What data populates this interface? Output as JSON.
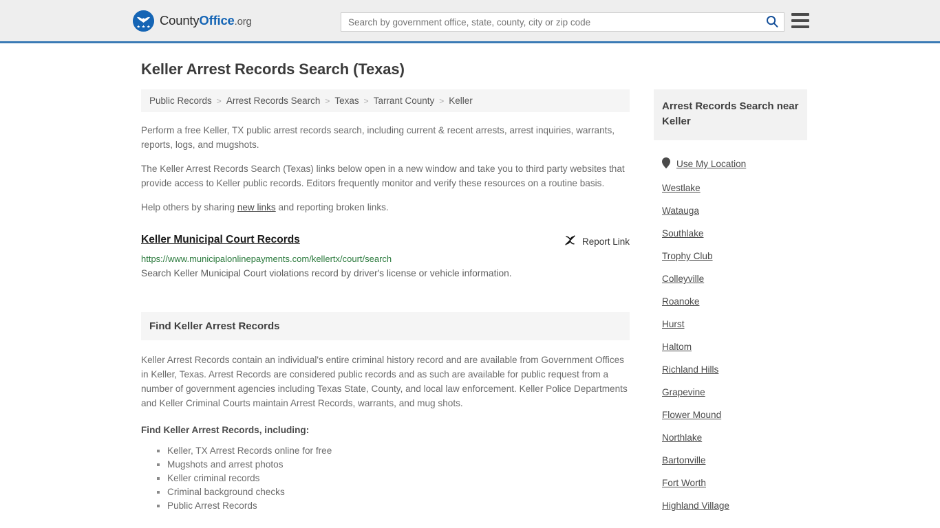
{
  "header": {
    "logo": {
      "icon": "eagle-shield-logo-icon",
      "text_part1": "County",
      "text_part2": "Office",
      "text_part3": ".org"
    },
    "search": {
      "placeholder": "Search by government office, state, county, city or zip code",
      "value": "",
      "search_icon": "search-icon"
    },
    "menu_icon": "hamburger-menu-icon",
    "accent_color": "#3b7ab5",
    "background_color": "#eeeeee"
  },
  "page_title": "Keller Arrest Records Search (Texas)",
  "breadcrumb": {
    "separator": ">",
    "items": [
      {
        "label": "Public Records"
      },
      {
        "label": "Arrest Records Search"
      },
      {
        "label": "Texas"
      },
      {
        "label": "Tarrant County"
      },
      {
        "label": "Keller"
      }
    ]
  },
  "intro": {
    "paragraph_1": "Perform a free Keller, TX public arrest records search, including current & recent arrests, arrest inquiries, warrants, reports, logs, and mugshots.",
    "paragraph_2": "The Keller Arrest Records Search (Texas) links below open in a new window and take you to third party websites that provide access to Keller public records. Editors frequently monitor and verify these resources on a routine basis.",
    "share_prefix": "Help others by sharing ",
    "share_link": "new links",
    "share_suffix": " and reporting broken links."
  },
  "results": [
    {
      "title": "Keller Municipal Court Records",
      "url": "https://www.municipalonlinepayments.com/kellertx/court/search",
      "description": "Search Keller Municipal Court violations record by driver's license or vehicle information.",
      "report_label": "Report Link",
      "report_icon": "broken-link-icon",
      "url_color": "#2b7a3d"
    }
  ],
  "section": {
    "heading": "Find Keller Arrest Records",
    "body": "Keller Arrest Records contain an individual's entire criminal history record and are available from Government Offices in Keller, Texas. Arrest Records are considered public records and as such are available for public request from a number of government agencies including Texas State, County, and local law enforcement. Keller Police Departments and Keller Criminal Courts maintain Arrest Records, warrants, and mug shots.",
    "list_intro": "Find Keller Arrest Records, including:",
    "list_items": [
      "Keller, TX Arrest Records online for free",
      "Mugshots and arrest photos",
      "Keller criminal records",
      "Criminal background checks",
      "Public Arrest Records"
    ]
  },
  "sidebar": {
    "heading": "Arrest Records Search near Keller",
    "location_item": {
      "label": "Use My Location",
      "icon": "map-pin-icon"
    },
    "items": [
      {
        "label": "Westlake"
      },
      {
        "label": "Watauga"
      },
      {
        "label": "Southlake"
      },
      {
        "label": "Trophy Club"
      },
      {
        "label": "Colleyville"
      },
      {
        "label": "Roanoke"
      },
      {
        "label": "Hurst"
      },
      {
        "label": "Haltom"
      },
      {
        "label": "Richland Hills"
      },
      {
        "label": "Grapevine"
      },
      {
        "label": "Flower Mound"
      },
      {
        "label": "Northlake"
      },
      {
        "label": "Bartonville"
      },
      {
        "label": "Fort Worth"
      },
      {
        "label": "Highland Village"
      }
    ]
  }
}
